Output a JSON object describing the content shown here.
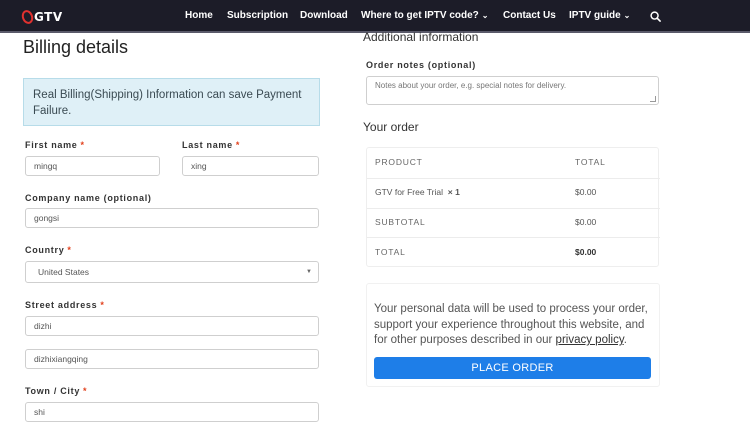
{
  "header": {
    "logo_text": "GTV",
    "nav": [
      {
        "label": "Home",
        "dropdown": false
      },
      {
        "label": "Subscription",
        "dropdown": false
      },
      {
        "label": "Download",
        "dropdown": false
      },
      {
        "label": "Where to get IPTV code?",
        "dropdown": true
      },
      {
        "label": "Contact Us",
        "dropdown": false
      },
      {
        "label": "IPTV guide",
        "dropdown": true
      }
    ],
    "search_icon": "search-icon",
    "caret_glyph": "⌄"
  },
  "billing": {
    "title": "Billing details",
    "notice": "Real Billing(Shipping) Information can save Payment Failure.",
    "required_mark": "*",
    "first_name_label": "First name",
    "first_name_value": "mingq",
    "last_name_label": "Last name",
    "last_name_value": "xing",
    "company_label": "Company name (optional)",
    "company_value": "gongsi",
    "country_label": "Country",
    "country_value": "United States",
    "street_label": "Street address",
    "street_value": "dizhi",
    "street2_value": "dizhixiangqing",
    "town_label": "Town / City",
    "town_value": "shi"
  },
  "additional": {
    "title": "Additional information",
    "notes_label": "Order notes (optional)",
    "notes_placeholder": "Notes about your order, e.g. special notes for delivery."
  },
  "order": {
    "title": "Your order",
    "col_product": "PRODUCT",
    "col_total": "TOTAL",
    "item_name": "GTV for Free Trial",
    "item_qty": "× 1",
    "item_total": "$0.00",
    "subtotal_label": "SUBTOTAL",
    "subtotal_value": "$0.00",
    "total_label": "TOTAL",
    "total_value": "$0.00"
  },
  "privacy": {
    "text_before": "Your personal data will be used to process your order, support your experience throughout this website, and for other purposes described in our ",
    "link": "privacy policy",
    "text_after": ".",
    "button": "PLACE ORDER"
  },
  "colors": {
    "header_bg": "#1c1c28",
    "accent_blue": "#1e7ee8",
    "notice_bg": "#dff0f7",
    "required_red": "#e2401c",
    "logo_red": "#e0312f"
  }
}
